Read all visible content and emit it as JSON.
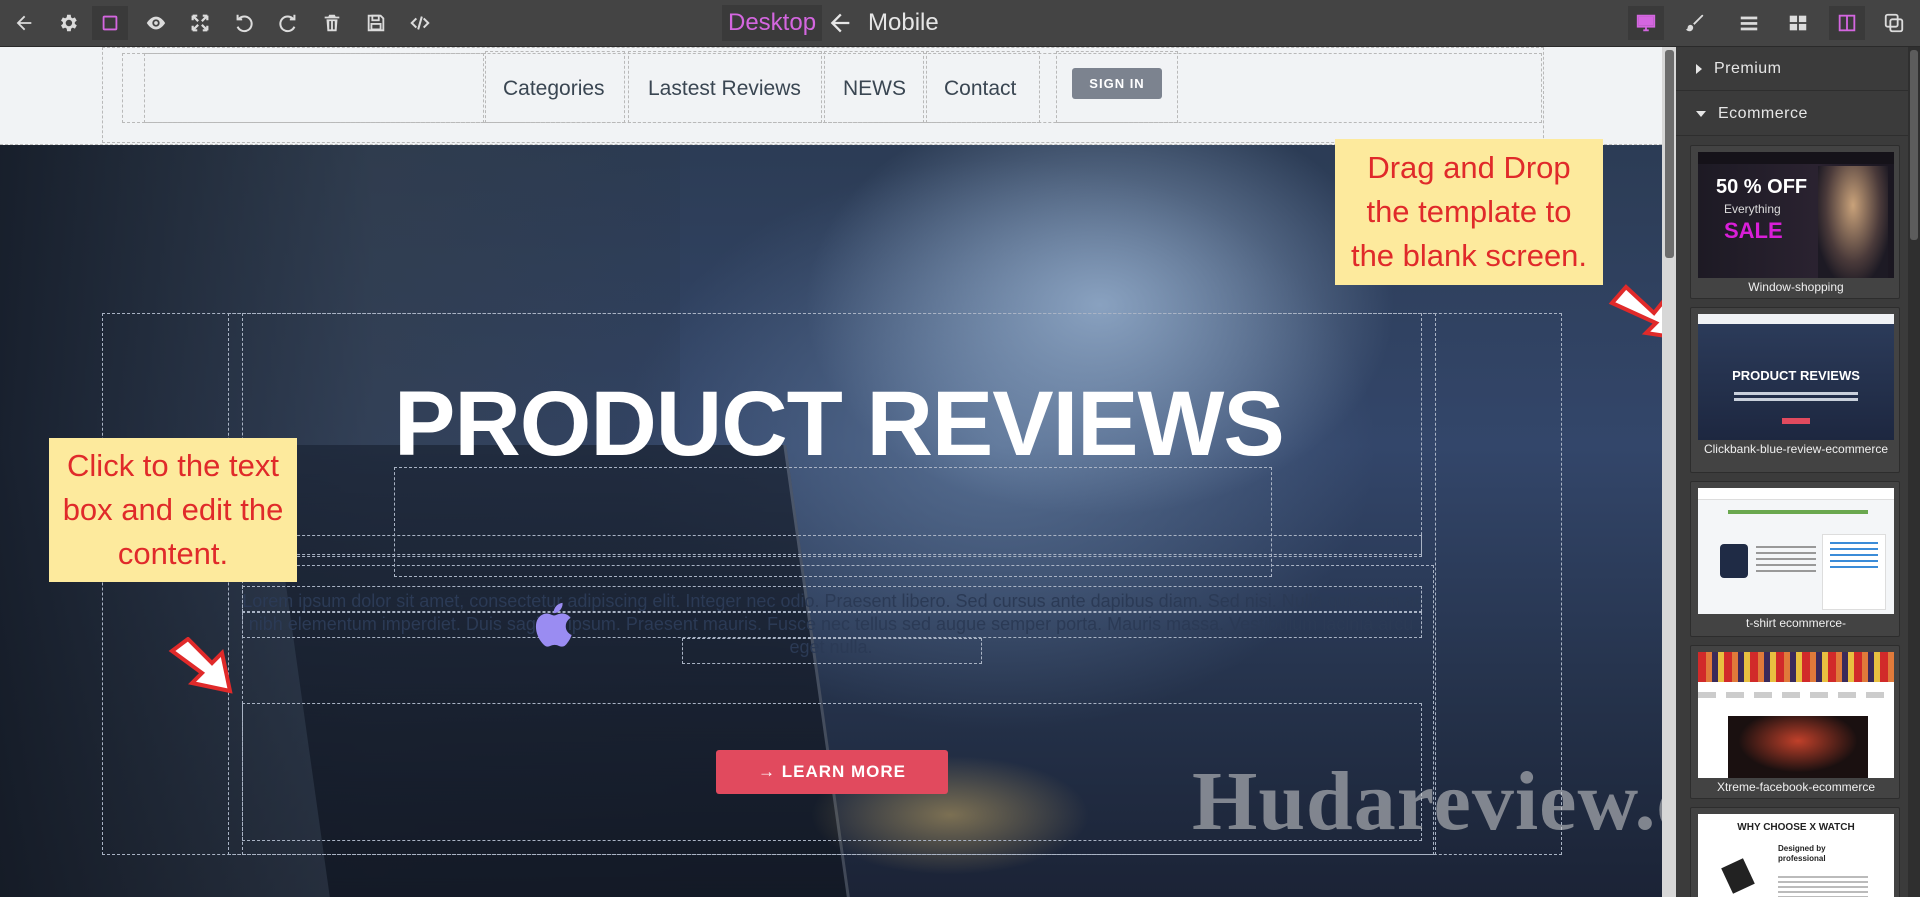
{
  "toolbar": {
    "left_icons": [
      "back-arrow-icon",
      "settings-gear-icon",
      "component-outline-icon",
      "preview-eye-icon",
      "fullscreen-icon",
      "undo-icon",
      "redo-icon",
      "trash-icon",
      "save-icon",
      "code-icon"
    ],
    "device_desktop": "Desktop",
    "device_mobile": "Mobile",
    "right_icons": [
      "desktop-monitor-icon",
      "style-brush-icon",
      "layer-manager-icon",
      "blocks-grid-icon",
      "split-panel-icon",
      "templates-icon"
    ]
  },
  "nav": {
    "links": [
      "Categories",
      "Lastest Reviews",
      "NEWS",
      "Contact"
    ],
    "signin": "SIGN IN"
  },
  "hero": {
    "title": "PRODUCT REVIEWS",
    "body": "Lorem ipsum dolor sit amet, consectetur adipiscing elit. Integer nec odio. Praesent libero. Sed cursus ante dapibus diam. Sed nisi. Nulla quis sem at nibh elementum imperdiet. Duis sagittis ipsum. Praesent mauris. Fusce nec tellus sed augue semper porta. Mauris massa. Vestibulum lacinia arcu eget nulla.",
    "cta": "→ LEARN MORE"
  },
  "annotations": {
    "left": "Click to the text box and edit the content.",
    "right": "Drag and Drop the template to the blank screen."
  },
  "watermark": "Hudareview.com",
  "panel": {
    "categories": [
      "Premium",
      "Ecommerce"
    ],
    "templates": [
      {
        "label": "Window-shopping",
        "thumb_line1": "50 % OFF",
        "thumb_line2": "Everything",
        "thumb_line3": "SALE"
      },
      {
        "label": "Clickbank-blue-review-ecommerce",
        "thumb_title": "PRODUCT REVIEWS"
      },
      {
        "label": "t-shirt ecommerce-"
      },
      {
        "label": "Xtreme-facebook-ecommerce"
      },
      {
        "label": "",
        "thumb_title": "WHY CHOOSE X WATCH",
        "thumb_sub": "Designed by professional"
      }
    ]
  },
  "colors": {
    "accent_pink": "#d466e0",
    "cta_red": "#e14a5e",
    "note_bg": "#fdea9d",
    "note_text": "#e02a2a"
  }
}
